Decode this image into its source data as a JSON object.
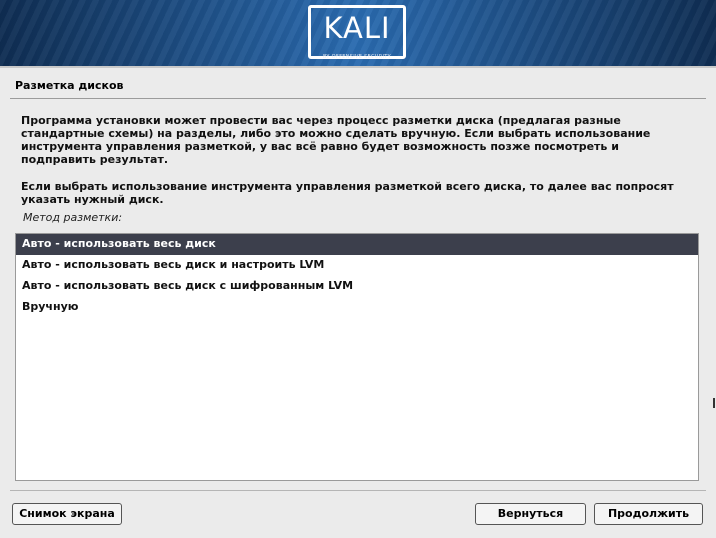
{
  "header": {
    "logo_text": "KALI",
    "logo_subtext": "BY OFFENSIVE SECURITY"
  },
  "page": {
    "title": "Разметка дисков",
    "paragraph1": "Программа установки может провести вас через процесс разметки диска (предлагая разные стандартные схемы) на разделы, либо это можно сделать вручную. Если выбрать использование инструмента управления разметкой, у вас всё равно будет возможность позже посмотреть и подправить результат.",
    "paragraph2": "Если выбрать использование инструмента управления разметкой всего диска, то далее вас попросят указать нужный диск.",
    "field_label": "Метод разметки:"
  },
  "options": {
    "selected_index": 0,
    "items": [
      {
        "label": "Авто - использовать весь диск"
      },
      {
        "label": "Авто - использовать весь диск и настроить LVM"
      },
      {
        "label": "Авто - использовать весь диск с шифрованным LVM"
      },
      {
        "label": "Вручную"
      }
    ]
  },
  "footer": {
    "screenshot_label": "Снимок экрана",
    "back_label": "Вернуться",
    "continue_label": "Продолжить"
  },
  "colors": {
    "banner_dark": "#0f2d52",
    "banner_light": "#2a6bb0",
    "selected_row": "#3c3f4c",
    "background": "#ebebeb"
  }
}
